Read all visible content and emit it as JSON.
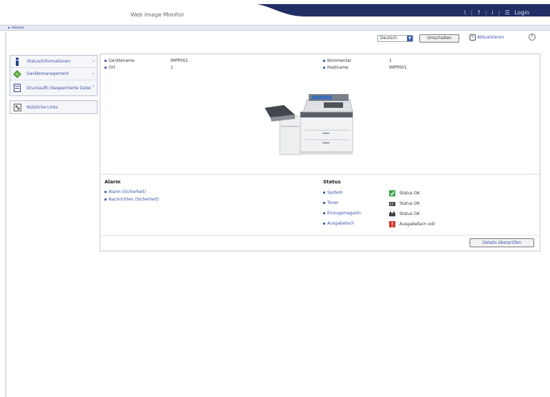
{
  "header": {
    "title": "Web Image Monitor",
    "nav": [
      "\\",
      "?",
      "i",
      "☰",
      "Login"
    ]
  },
  "homebar": {
    "home_link": "▸ Home"
  },
  "controls": {
    "language": "Deutsch",
    "switch_label": "Umschalten",
    "refresh_label": "Aktualisieren",
    "help_glyph": "?"
  },
  "sidebar": {
    "items": [
      {
        "label": "Status/Informationen",
        "icon": "info-icon"
      },
      {
        "label": "Gerätemanagement",
        "icon": "diamond-icon"
      },
      {
        "label": "Druckauftr./Gespeicherte Datei",
        "icon": "document-icon"
      },
      {
        "label": "Nützliche Links",
        "icon": "links-icon"
      }
    ]
  },
  "device_info": {
    "name_label": "Gerätename",
    "name_value": "IMPP001",
    "location_label": "Ort",
    "location_value": "1",
    "comment_label": "Kommentar",
    "comment_value": "1",
    "host_label": "Hostname",
    "host_value": "IMPP001"
  },
  "alarms": {
    "title": "Alarm",
    "links": [
      "Alarm (Sicherheit)",
      "Nachrichten (Sicherheit)"
    ]
  },
  "status": {
    "title": "Status",
    "rows": [
      {
        "label": "System",
        "value": "Status OK",
        "icon": "printer-ok-icon",
        "color": "#3aa84a"
      },
      {
        "label": "Toner",
        "value": "Status OK",
        "icon": "toner-icon",
        "color": "#444444"
      },
      {
        "label": "Einzugsmagazin",
        "value": "Status OK",
        "icon": "tray-icon",
        "color": "#444444"
      },
      {
        "label": "Ausgabefach",
        "value": "Ausgabefach voll",
        "icon": "output-full-icon",
        "color": "#d9302b"
      }
    ]
  },
  "details_button": "Details überprüfen",
  "colors": {
    "nav_band": "#1f2e64",
    "accent": "#3c5fb4",
    "link": "#3a4fa8"
  }
}
